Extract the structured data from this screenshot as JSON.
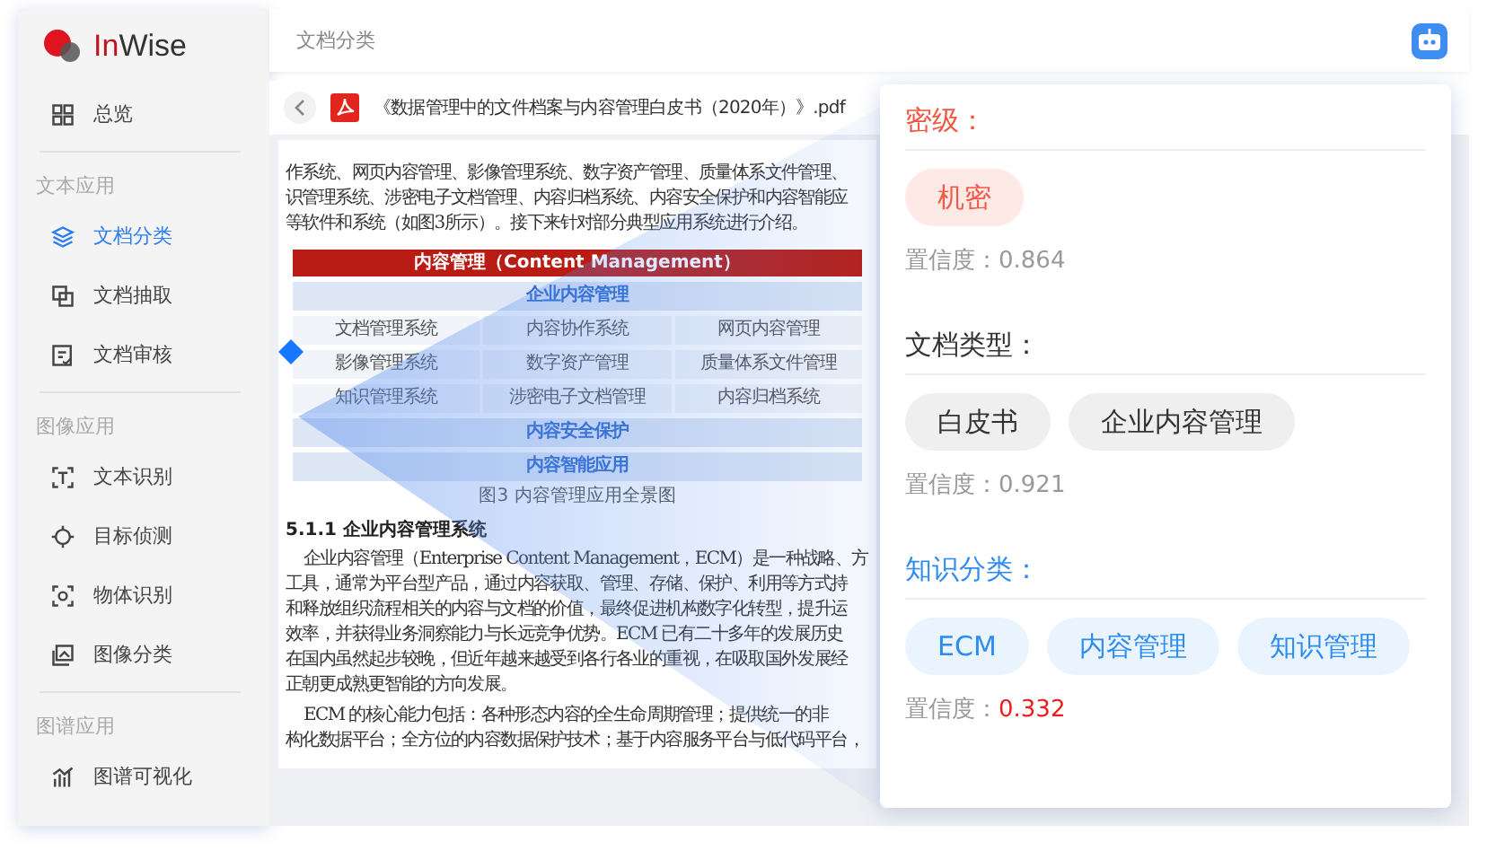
{
  "brand": {
    "prefix": "In",
    "name": "Wise"
  },
  "sidebar": {
    "sections": [
      {
        "items": [
          {
            "label": "总览",
            "selected": false
          }
        ]
      },
      {
        "title": "文本应用",
        "items": [
          {
            "label": "文档分类",
            "selected": true
          },
          {
            "label": "文档抽取",
            "selected": false
          },
          {
            "label": "文档审核",
            "selected": false
          }
        ]
      },
      {
        "title": "图像应用",
        "items": [
          {
            "label": "文本识别",
            "selected": false
          },
          {
            "label": "目标侦测",
            "selected": false
          },
          {
            "label": "物体识别",
            "selected": false
          },
          {
            "label": "图像分类",
            "selected": false
          }
        ]
      },
      {
        "title": "图谱应用",
        "items": [
          {
            "label": "图谱可视化",
            "selected": false
          }
        ]
      }
    ]
  },
  "header": {
    "title": "文档分类"
  },
  "file": {
    "name": "《数据管理中的文件档案与内容管理白皮书（2020年）》.pdf"
  },
  "document": {
    "blocks": [
      {
        "kind": "text",
        "indent": false,
        "lines": [
          "作系统、网页内容管理、影像管理系统、数字资产管理、质量体系文件管理、",
          "识管理系统、涉密电子文档管理、内容归档系统、内容安全保护和内容智能应",
          "等软件和系统（如图3所示）。接下来针对部分典型应用系统进行介绍。"
        ]
      },
      {
        "kind": "figure",
        "header": "内容管理（Content Management）",
        "rows": [
          {
            "kind": "band",
            "cells": [
              "企业内容管理"
            ]
          },
          {
            "kind": "grid",
            "cells": [
              "文档管理系统",
              "内容协作系统",
              "网页内容管理"
            ]
          },
          {
            "kind": "grid",
            "cells": [
              "影像管理系统",
              "数字资产管理",
              "质量体系文件管理"
            ]
          },
          {
            "kind": "grid",
            "cells": [
              "知识管理系统",
              "涉密电子文档管理",
              "内容归档系统"
            ]
          },
          {
            "kind": "band",
            "cells": [
              "内容安全保护"
            ]
          },
          {
            "kind": "band",
            "cells": [
              "内容智能应用"
            ]
          }
        ],
        "caption": "图3 内容管理应用全景图"
      },
      {
        "kind": "heading",
        "text": "5.1.1 企业内容管理系统"
      },
      {
        "kind": "text",
        "indent": true,
        "lines": [
          "企业内容管理（Enterprise Content Management，ECM）是一种战略、方",
          "工具，通常为平台型产品，通过内容获取、管理、存储、保护、利用等方式持",
          "和释放组织流程相关的内容与文档的价值，最终促进机构数字化转型，提升运",
          "效率，并获得业务洞察能力与长远竞争优势。ECM 已有二十多年的发展历史",
          "在国内虽然起步较晚，但近年越来越受到各行各业的重视，在吸取国外发展经",
          "正朝更成熟更智能的方向发展。"
        ]
      },
      {
        "kind": "text",
        "indent": true,
        "lines": [
          "ECM 的核心能力包括：各种形态内容的全生命周期管理；提供统一的非",
          "构化数据平台；全方位的内容数据保护技术；基于内容服务平台与低代码平台，"
        ]
      }
    ]
  },
  "results": [
    {
      "kind": "danger",
      "title": "密级：",
      "tags": [
        "机密"
      ],
      "confidence_label": "置信度：",
      "confidence": "0.864",
      "low": false
    },
    {
      "kind": "neutral",
      "title": "文档类型：",
      "tags": [
        "白皮书",
        "企业内容管理"
      ],
      "confidence_label": "置信度：",
      "confidence": "0.921",
      "low": false
    },
    {
      "kind": "info",
      "title": "知识分类：",
      "tags": [
        "ECM",
        "内容管理",
        "知识管理"
      ],
      "confidence_label": "置信度：",
      "confidence": "0.332",
      "low": true
    }
  ]
}
